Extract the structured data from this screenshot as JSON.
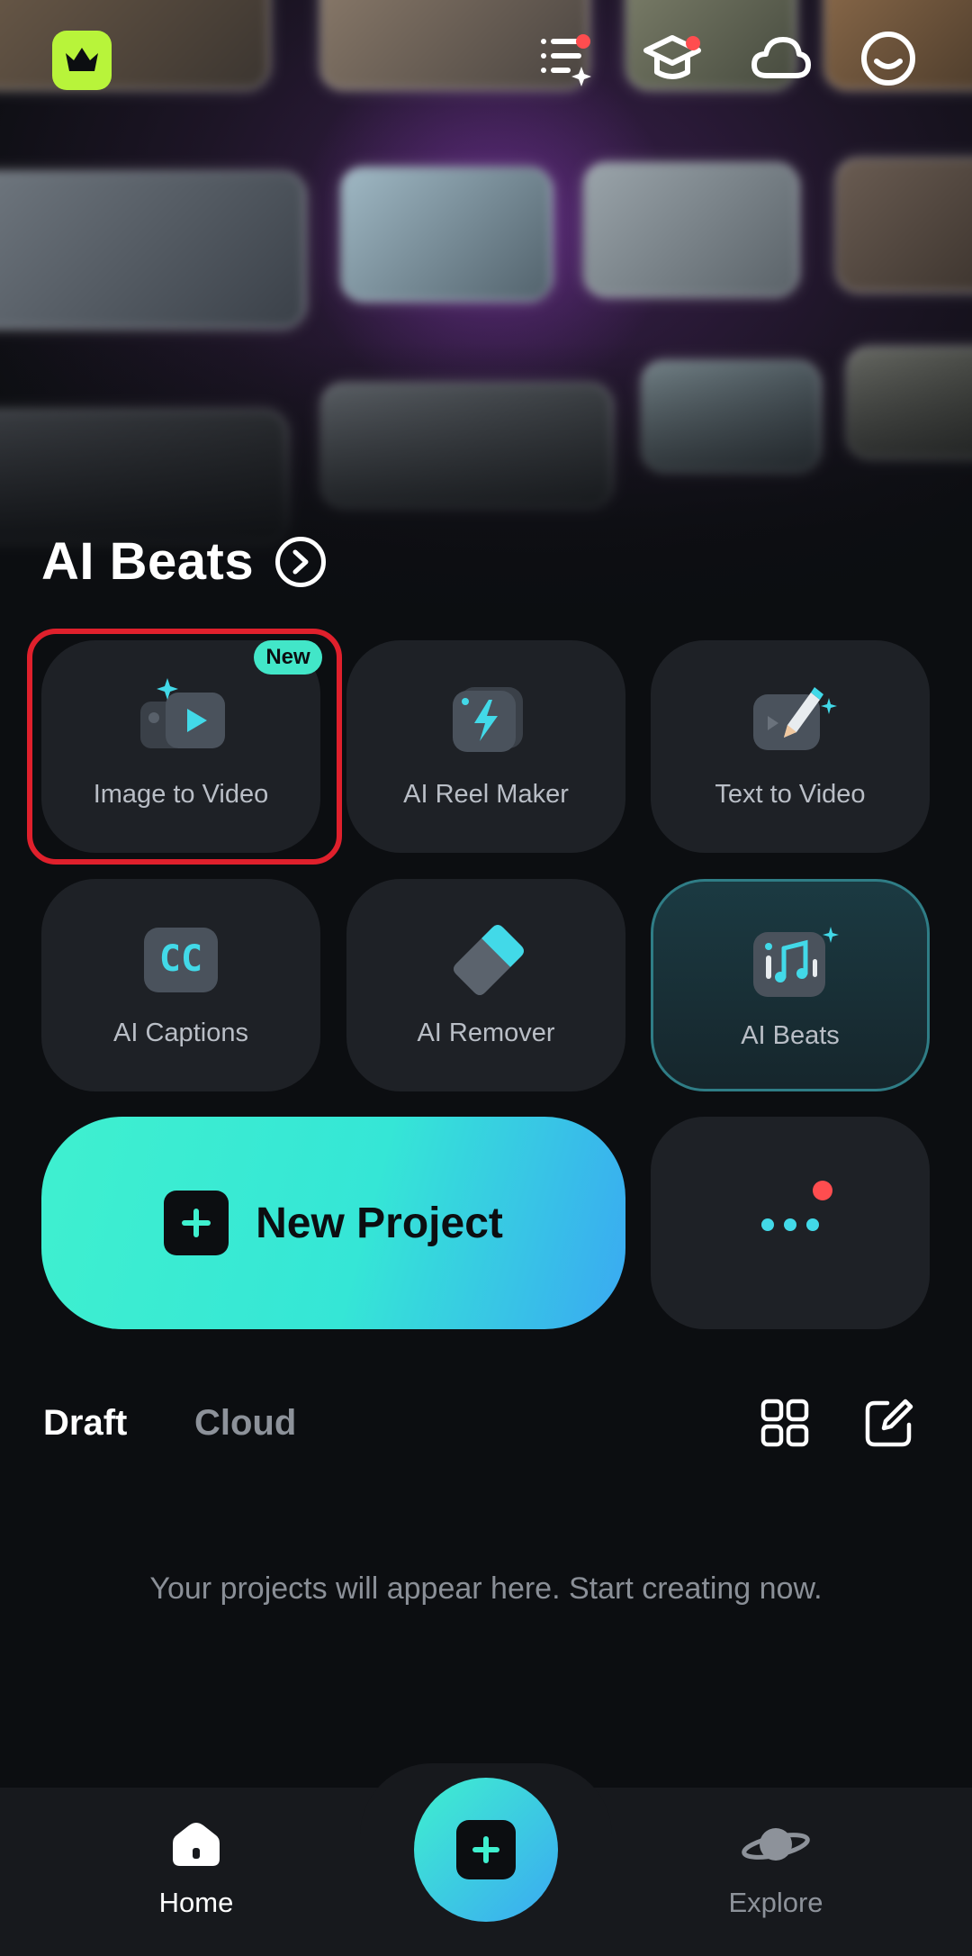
{
  "section": {
    "title": "AI Beats"
  },
  "tools": [
    {
      "label": "Image to Video",
      "badge": "New",
      "icon": "image-to-video-icon"
    },
    {
      "label": "AI Reel Maker",
      "icon": "lightning-icon"
    },
    {
      "label": "Text to Video",
      "icon": "pencil-sparkle-icon"
    },
    {
      "label": "AI Captions",
      "icon": "cc-icon"
    },
    {
      "label": "AI Remover",
      "icon": "eraser-icon"
    },
    {
      "label": "AI Beats",
      "icon": "music-beats-icon"
    }
  ],
  "new_project": {
    "label": "New Project"
  },
  "tabs": {
    "draft": "Draft",
    "cloud": "Cloud"
  },
  "empty_message": "Your projects will appear here. Start creating now.",
  "nav": {
    "home": "Home",
    "explore": "Explore"
  },
  "colors": {
    "accent": "#3ff0cf",
    "accent_blue": "#3aa9f2",
    "premium": "#b8f43a",
    "notification": "#ff4d4f",
    "highlight": "#e0202c"
  }
}
